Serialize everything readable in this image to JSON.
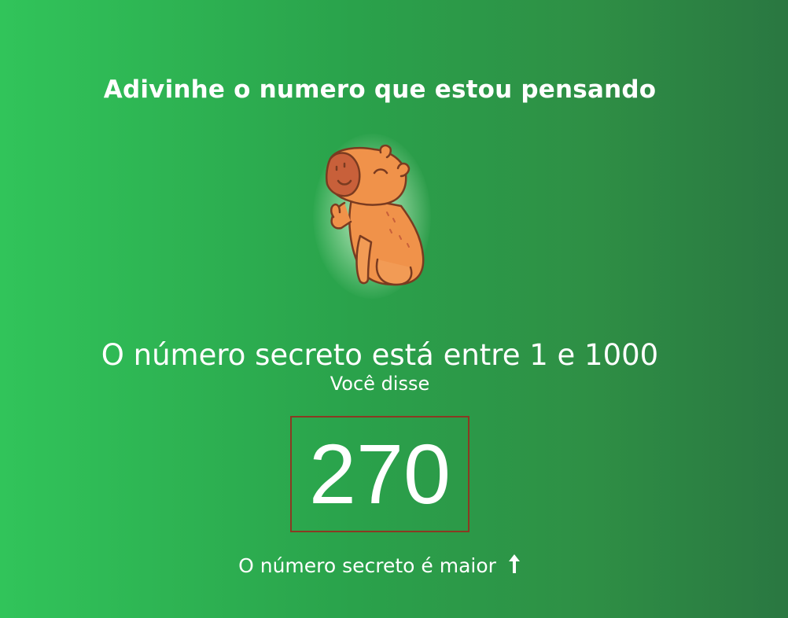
{
  "game": {
    "title": "Adivinhe o numero que estou pensando",
    "range_text": "O número secreto está entre 1 e 1000",
    "you_said_label": "Você disse",
    "guess_value": "270",
    "result_text": "O número secreto é maior"
  },
  "icons": {
    "mascot": "capybara-thumbs-up-icon",
    "direction": "arrow-up-icon"
  },
  "colors": {
    "background_start": "#31c45a",
    "background_end": "#2a7741",
    "guess_border": "#8a3a22",
    "text": "#ffffff",
    "mascot_body": "#f0924a",
    "mascot_outline": "#7a3b20"
  }
}
